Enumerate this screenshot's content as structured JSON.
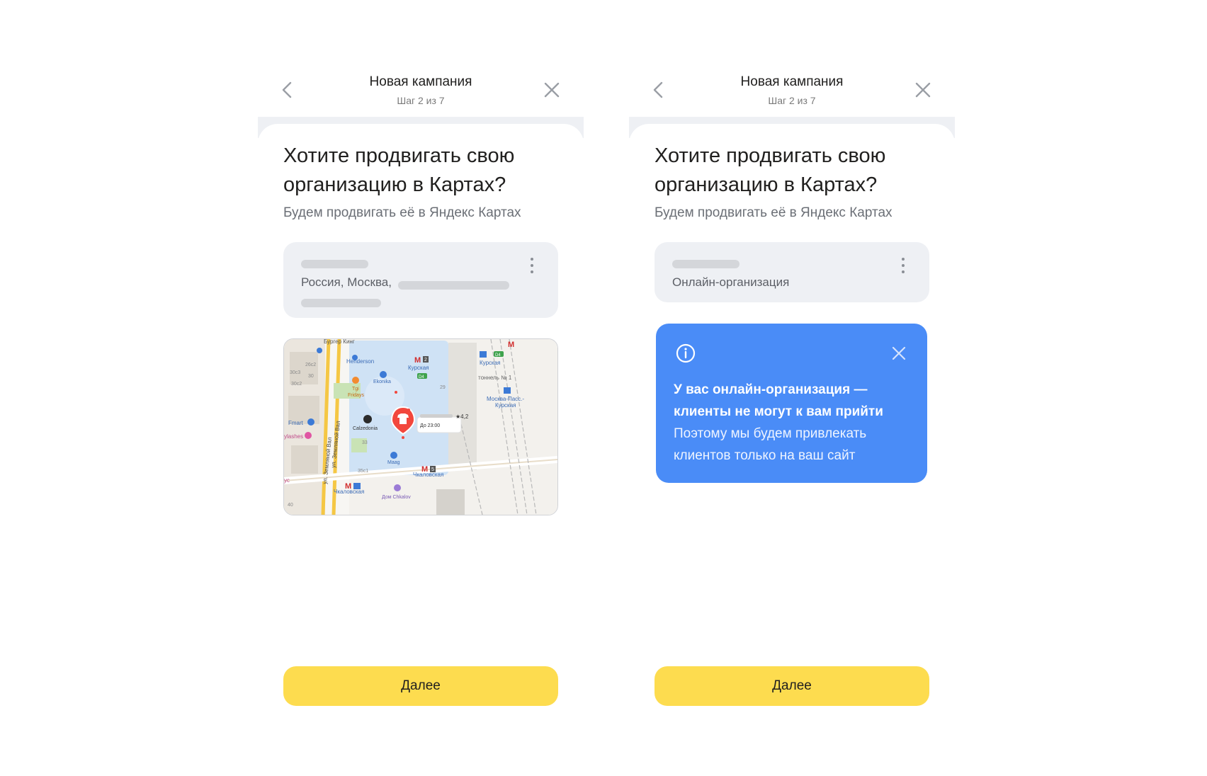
{
  "left_screen": {
    "header": {
      "title": "Новая кампания",
      "step": "Шаг 2 из 7"
    },
    "question": {
      "title": "Хотите продвигать свою организацию в Картах?",
      "subtitle": "Будем продвигать её в Яндекс Картах"
    },
    "org_card": {
      "address_prefix": "Россия, Москва,"
    },
    "map": {
      "labels": {
        "burger": "Бургер Кинг",
        "henderson": "Henderson",
        "ekonika": "Ekonika",
        "tgi": "Tgi",
        "fridays": "Fridays",
        "kurskaya_a": "Курская",
        "kurskaya_b": "Курская",
        "tonnel": "тоннель № 1",
        "moskva_pass": "Москва-Пасс.-",
        "kurskaya_c": "Курская",
        "calzedonia": "Calzedonia",
        "do_2300": "До 23:00",
        "rating": "★4,2",
        "fmart": "Fmart",
        "flashes": "ylashes",
        "street_1": "ул. Земляной Вал",
        "street_2": "ул. Земляной Вал",
        "maag": "Maag",
        "chkalovskaya_a": "Чкаловская",
        "chkalovskaya_b": "Чкаловская",
        "dom_chkalov": "Дом Chkalov",
        "b26c2": "26с2",
        "b30c3": "30с3",
        "b30": "30",
        "b30c2": "30с2",
        "b29": "29",
        "b33": "33",
        "b35c1": "35с1",
        "b40": "40",
        "metro_2": "2",
        "metro_5": "5",
        "d2": "D2",
        "d4": "D4",
        "k_yc": "ус"
      }
    },
    "next_button": "Далее"
  },
  "right_screen": {
    "header": {
      "title": "Новая кампания",
      "step": "Шаг 2 из 7"
    },
    "question": {
      "title": "Хотите продвигать свою организацию в Картах?",
      "subtitle": "Будем продвигать её в Яндекс Картах"
    },
    "org_card": {
      "type_label": "Онлайн-организация"
    },
    "info_banner": {
      "bold_text": "У вас онлайн-организация — клиенты не могут к вам прийти",
      "text": "Поэтому мы будем привлекать клиентов только на ваш сайт"
    },
    "next_button": "Далее"
  },
  "colors": {
    "accent_yellow": "#fddc4f",
    "info_blue": "#4a8cf7",
    "card_gray": "#eef0f4",
    "pin_red": "#f2473d"
  }
}
